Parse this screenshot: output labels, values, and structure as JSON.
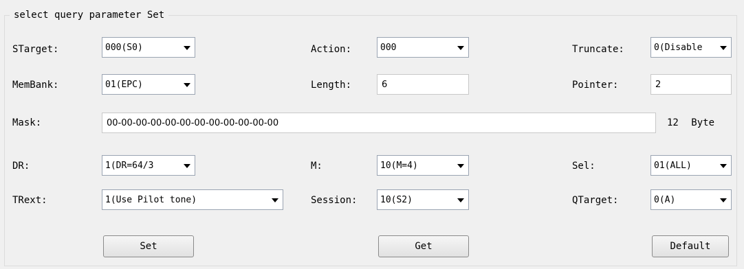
{
  "group": {
    "title": "select query parameter Set"
  },
  "fields": {
    "starget": {
      "label": "STarget:",
      "value": "000(S0)"
    },
    "action": {
      "label": "Action:",
      "value": "000"
    },
    "truncate": {
      "label": "Truncate:",
      "value": "0(Disable"
    },
    "membank": {
      "label": "MemBank:",
      "value": "01(EPC)"
    },
    "length": {
      "label": "Length:",
      "value": "6"
    },
    "pointer": {
      "label": "Pointer:",
      "value": "2"
    },
    "mask": {
      "label": "Mask:",
      "value": "00-00-00-00-00-00-00-00-00-00-00-00"
    },
    "mask_len": {
      "value": "12",
      "unit": "Byte"
    },
    "dr": {
      "label": "DR:",
      "value": "1(DR=64/3"
    },
    "m": {
      "label": "M:",
      "value": "10(M=4)"
    },
    "sel": {
      "label": "Sel:",
      "value": "01(ALL)"
    },
    "trext": {
      "label": "TRext:",
      "value": "1(Use Pilot tone)"
    },
    "session": {
      "label": "Session:",
      "value": "10(S2)"
    },
    "qtarget": {
      "label": "QTarget:",
      "value": "0(A)"
    }
  },
  "buttons": {
    "set": "Set",
    "get": "Get",
    "default": "Default"
  },
  "icons": {
    "dropdown": "chevron-down-icon"
  }
}
